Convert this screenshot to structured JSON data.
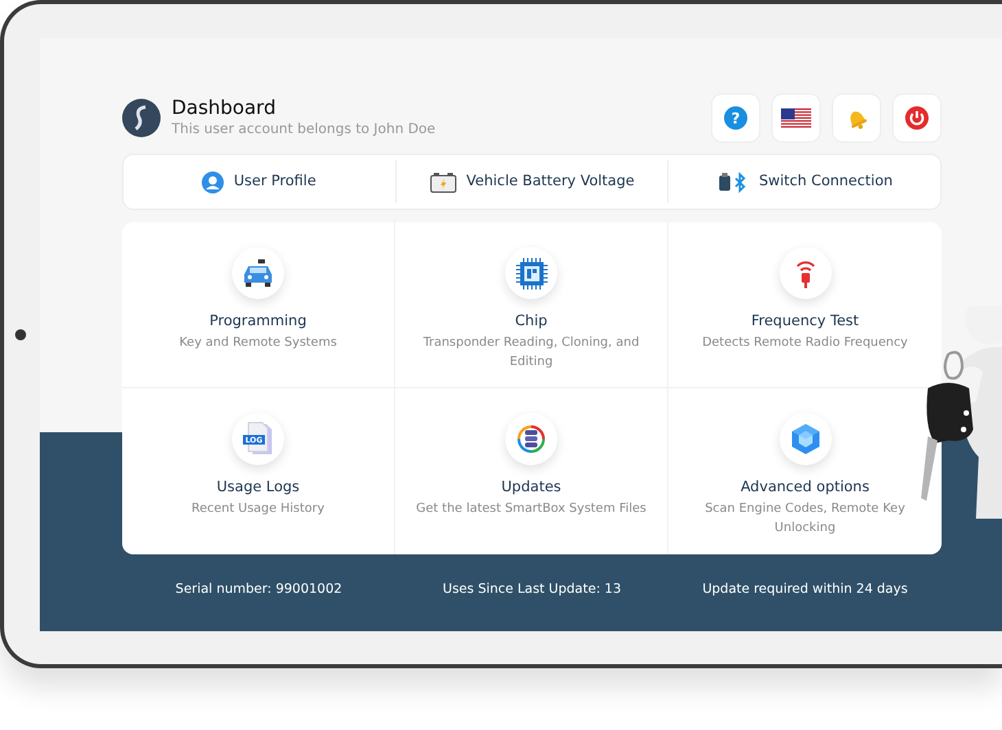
{
  "header": {
    "title": "Dashboard",
    "subtitle": "This user account belongs to John Doe"
  },
  "header_buttons": [
    {
      "kind": "help",
      "glyph": "?"
    },
    {
      "kind": "flag"
    },
    {
      "kind": "bell"
    },
    {
      "kind": "power"
    }
  ],
  "nav": [
    {
      "label": "User Profile",
      "kind": "user"
    },
    {
      "label": "Vehicle Battery Voltage",
      "kind": "battery"
    },
    {
      "label": "Switch Connection",
      "kind": "connection"
    }
  ],
  "tiles": [
    {
      "title": "Programming",
      "subtitle": "Key and Remote Systems",
      "kind": "car"
    },
    {
      "title": "Chip",
      "subtitle": "Transponder Reading, Cloning, and Editing",
      "kind": "chip"
    },
    {
      "title": "Frequency Test",
      "subtitle": "Detects Remote Radio Frequency",
      "kind": "signal"
    },
    {
      "title": "Usage Logs",
      "subtitle": "Recent Usage History",
      "kind": "log",
      "badge": "LOG"
    },
    {
      "title": "Updates",
      "subtitle": "Get the latest SmartBox System Files",
      "kind": "update"
    },
    {
      "title": "Advanced options",
      "subtitle": "Scan Engine Codes, Remote Key Unlocking",
      "kind": "cube"
    }
  ],
  "status_bar": [
    "Serial number: 99001002",
    "Uses Since Last Update: 13",
    "Update required within 24 days"
  ]
}
